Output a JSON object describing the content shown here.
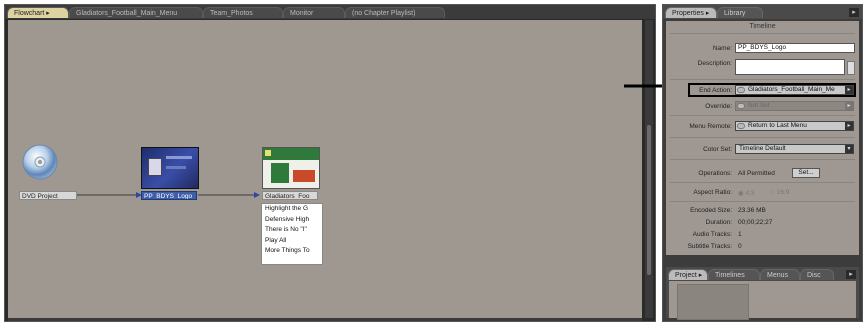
{
  "flowchart_panel": {
    "tabs": [
      {
        "label": "Flowchart",
        "active": true
      },
      {
        "label": "Gladiators_Football_Main_Menu",
        "active": false
      },
      {
        "label": "Team_Photos",
        "active": false
      },
      {
        "label": "Monitor",
        "active": false
      },
      {
        "label": "(no Chapter Playlist)",
        "active": false
      }
    ],
    "nodes": {
      "dvd_project": "DVD Project",
      "timeline": "PP_BDYS_Logo",
      "menu": "Gladiators_Foo"
    },
    "menu_buttons": [
      "Highlight the G",
      "Defensive High",
      "There is No \"I\"",
      "Play All",
      "More Things To"
    ]
  },
  "properties_panel": {
    "tabs": [
      {
        "label": "Properties",
        "active": true
      },
      {
        "label": "Library",
        "active": false
      }
    ],
    "section": "Timeline",
    "name_label": "Name:",
    "name_value": "PP_BDYS_Logo",
    "description_label": "Description:",
    "description_value": "",
    "end_action_label": "End Action:",
    "end_action_value": "Gladiators_Football_Main_Me",
    "override_label": "Override:",
    "override_value": "Not Set",
    "menu_remote_label": "Menu Remote:",
    "menu_remote_value": "Return to Last Menu",
    "color_set_label": "Color Set:",
    "color_set_value": "Timeline Default",
    "operations_label": "Operations:",
    "operations_value": "All Permitted",
    "set_button": "Set...",
    "aspect_ratio_label": "Aspect Ratio:",
    "aspect_4_3": "4:3",
    "aspect_16_9": "16:9",
    "encoded_size_label": "Encoded Size:",
    "encoded_size_value": "23.36 MB",
    "duration_label": "Duration:",
    "duration_value": "00;00;22;27",
    "audio_tracks_label": "Audio Tracks:",
    "audio_tracks_value": "1",
    "subtitle_tracks_label": "Subtitle Tracks:",
    "subtitle_tracks_value": "0"
  },
  "bottom_panel": {
    "tabs": [
      {
        "label": "Project",
        "active": true
      },
      {
        "label": "Timelines",
        "active": false
      },
      {
        "label": "Menus",
        "active": false
      },
      {
        "label": "Disc",
        "active": false
      }
    ]
  },
  "colors": {
    "canvas": "#9e9891",
    "selected_node": "#3d5ea8",
    "panel_dark": "#3c3c3c",
    "callout_arrow": "#000000"
  },
  "icons": [
    "dvd-disc-icon",
    "timeline-thumbnail-icon",
    "menu-thumbnail-icon",
    "dropdown-arrow-icon",
    "link-pickwhip-icon",
    "panel-menu-icon"
  ]
}
